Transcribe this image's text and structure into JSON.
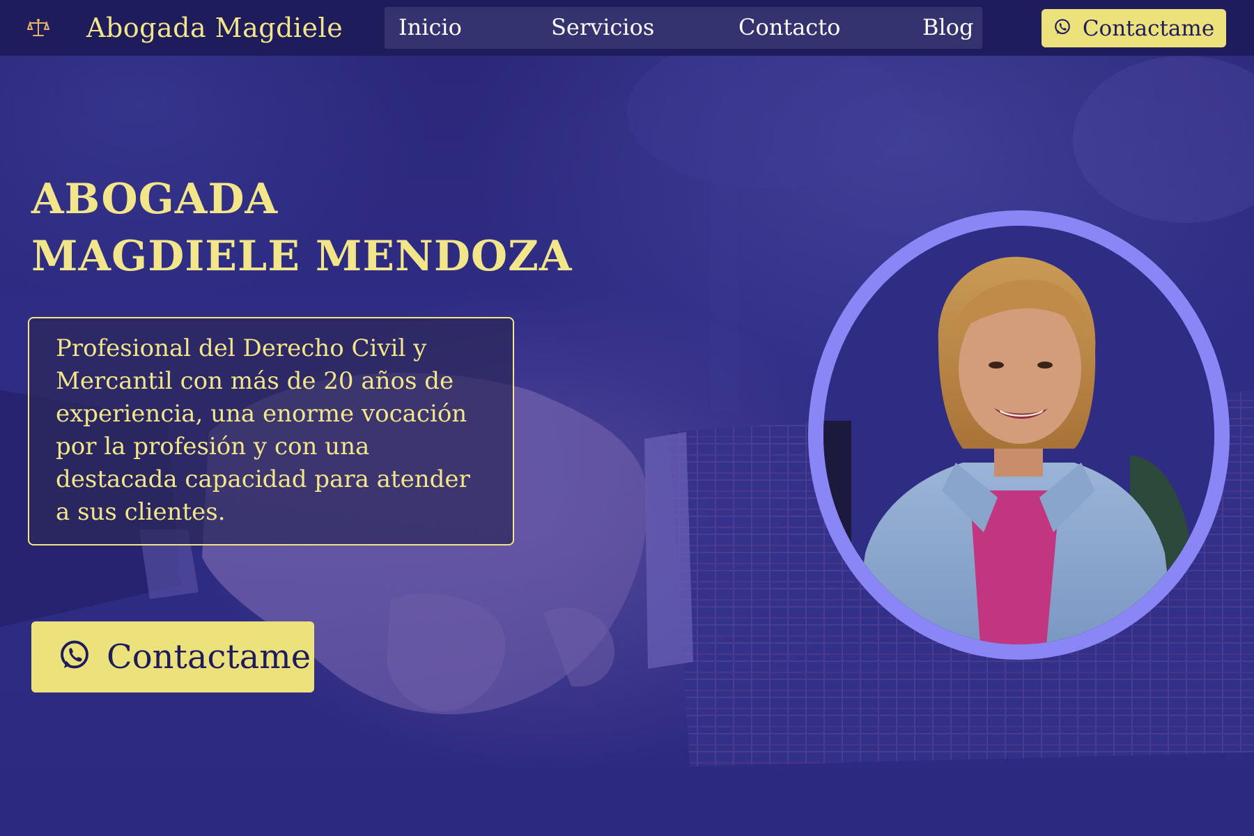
{
  "navbar": {
    "brand_icon": "scales-of-justice-icon",
    "brand_name": "Abogada Magdiele",
    "links": [
      {
        "label": "Inicio"
      },
      {
        "label": "Servicios"
      },
      {
        "label": "Contacto"
      },
      {
        "label": "Blog"
      }
    ],
    "cta_icon": "whatsapp-icon",
    "cta_label": "Contactame"
  },
  "hero": {
    "title_line1": "ABOGADA",
    "title_line2": "MAGDIELE MENDOZA",
    "description": "Profesional del Derecho Civil y Mercantil con más de 20 años de experiencia, una enorme vocación por la profesión y con una destacada capacidad para atender a sus clientes.",
    "cta_icon": "whatsapp-icon",
    "cta_label": "Contactame"
  },
  "colors": {
    "accent_yellow": "#ece27c",
    "text_yellow": "#f3e68a",
    "navbar_bg": "#1f1c5c",
    "portrait_ring": "#8b86f5",
    "hero_bg": "#2f2c85"
  }
}
